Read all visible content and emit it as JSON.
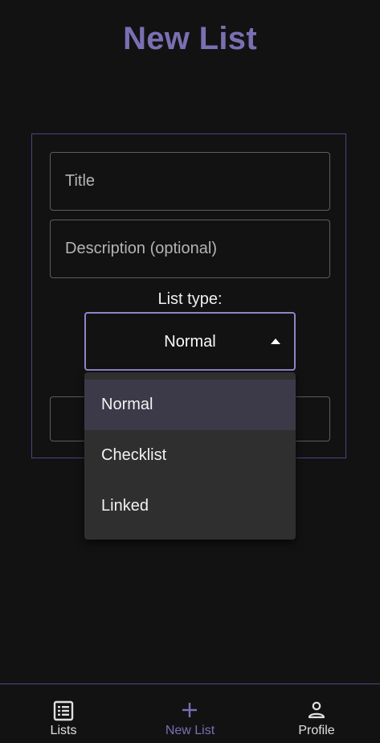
{
  "page": {
    "title": "New List"
  },
  "form": {
    "title_placeholder": "Title",
    "description_placeholder": "Description (optional)",
    "list_type_label": "List type:",
    "selected_type": "Normal",
    "type_options": [
      "Normal",
      "Checklist",
      "Linked"
    ]
  },
  "bottom_nav": {
    "items": [
      {
        "label": "Lists",
        "icon": "list-icon"
      },
      {
        "label": "New List",
        "icon": "plus-icon",
        "active": true
      },
      {
        "label": "Profile",
        "icon": "person-icon"
      }
    ]
  },
  "colors": {
    "accent": "#7b6fb3",
    "background": "#121212",
    "menu_background": "#2f2f2f",
    "menu_selected": "#3c3a48"
  }
}
